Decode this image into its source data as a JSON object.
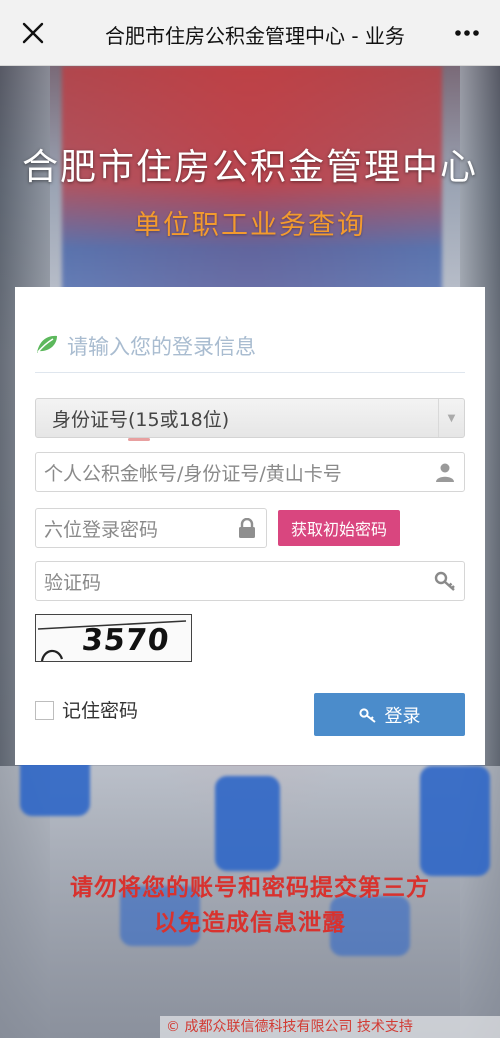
{
  "navbar": {
    "title": "合肥市住房公积金管理中心 - 业务",
    "close_icon": "close-icon",
    "more_icon": "more-icon"
  },
  "header": {
    "title": "合肥市住房公积金管理中心",
    "subtitle": "单位职工业务查询"
  },
  "login": {
    "heading": "请输入您的登录信息",
    "id_type_selected": "身份证号(15或18位)",
    "account_placeholder": "个人公积金帐号/身份证号/黄山卡号",
    "password_placeholder": "六位登录密码",
    "get_password_label": "获取初始密码",
    "captcha_placeholder": "验证码",
    "captcha_image_text": "3570",
    "remember_label": "记住密码",
    "login_label": "登录"
  },
  "warning": {
    "line1": "请勿将您的账号和密码提交第三方",
    "line2": "以免造成信息泄露"
  },
  "footer": {
    "text": "© 成都众联信德科技有限公司  技术支持"
  },
  "colors": {
    "accent_blue": "#4b8ccb",
    "pink_button": "#d9467f",
    "subtitle_orange": "#f39a2e",
    "warning_red": "#d8322e"
  }
}
